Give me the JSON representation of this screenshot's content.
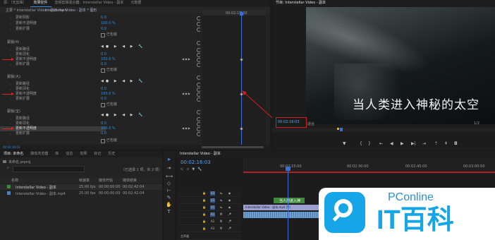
{
  "colors": {
    "accent": "#2d8ceb",
    "value_blue": "#3a8ddd",
    "timecode_blue": "#5aa6f0",
    "annotation_red": "#d41e1e",
    "clip_video": "#9b9fcf",
    "clip_audio": "#6f9fcf",
    "clip_green": "#3f8a3f",
    "playhead": "#3b6fd8"
  },
  "left_tabs": {
    "source": "源：（无剪辑）",
    "effect_controls": "效果控件",
    "audio_mixer": "音频剪辑混合器：Interstellar Video - 副本",
    "metadata": "元数据"
  },
  "ec_header": {
    "path": "主要 * Interstellar Video - 副本.mp4",
    "sequence": "Interstellar Video - 副本 * 图形",
    "timecode": "00:02:15:00"
  },
  "effect_rows": {
    "r1": {
      "label": "更新阴影",
      "value": "0.0"
    },
    "r2": {
      "label": "更新不透明度",
      "value": "100.0 %"
    },
    "r3": {
      "label": "更新扩展",
      "value": "0.0"
    },
    "r4": {
      "label": "已包装",
      "value": ""
    },
    "g1": {
      "label": "蒙版(4)"
    },
    "r5": {
      "label": "更新路径",
      "value": ""
    },
    "r6": {
      "label": "更新羽化",
      "value": "0.0"
    },
    "r7": {
      "label": "更新不透明度",
      "value": "100.0 %"
    },
    "r8": {
      "label": "更新扩展",
      "value": "0.0"
    },
    "r9": {
      "label": "已包装",
      "value": ""
    },
    "g2": {
      "label": "蒙版(大)"
    },
    "r10": {
      "label": "更新路径",
      "value": ""
    },
    "r11": {
      "label": "更新羽化",
      "value": "0.0"
    },
    "r12": {
      "label": "更新不透明度",
      "value": "100.0 %"
    },
    "r13": {
      "label": "更新扩展",
      "value": "0.0"
    },
    "r14": {
      "label": "已包装",
      "value": ""
    },
    "g3": {
      "label": "蒙版(宝)"
    },
    "r15": {
      "label": "更新路径",
      "value": ""
    },
    "r16": {
      "label": "更新羽化",
      "value": "0.0"
    },
    "r17": {
      "label": "更新不透明度",
      "value": "100.0 %"
    },
    "r18": {
      "label": "更新扩展",
      "value": "0.0"
    },
    "r19": {
      "label": "已包装",
      "value": ""
    }
  },
  "ec_bottom_timecode": "00:02:16:03",
  "program": {
    "title": "节目: Interstellar Video - 副本",
    "subtitle": "当人类进入神秘的太空",
    "timecode": "00:02:16:03",
    "fit": "适合",
    "ratio": "1/2"
  },
  "project": {
    "tabs": {
      "project": "项目: 未命名",
      "media_browser": "媒体浏览器",
      "library": "库",
      "info": "信息",
      "effects": "效果",
      "markers": "标记",
      "history": "历史"
    },
    "file": "未命名.prproj",
    "count": "（已选择 1 项，共 2 项）",
    "columns": {
      "name": "名称",
      "fps": "帧速率",
      "start": "媒体开始",
      "end": "媒体结束"
    },
    "items": [
      {
        "name": "Interstellar Video - 副本",
        "fps": "25.00 fps",
        "start": "00:00:00:00",
        "end": "00:02:42:04"
      },
      {
        "name": "Interstellar Video - 副本.mp4",
        "fps": "25.00 fps",
        "start": "00:00:00:00",
        "end": "00:02:42:04"
      }
    ]
  },
  "timeline": {
    "title": "Interstellar Video - 副本",
    "timecode": "00:02:16:03",
    "ruler": {
      "t1": "00:02:15:00",
      "t2": "00:02:30:00",
      "t3": "00:02:45:00",
      "t4": "00:03:00:00"
    },
    "tracks": {
      "v3": "V3",
      "v2": "V2",
      "v1": "V1",
      "a1": "A1",
      "a2": "A2",
      "a3": "A3",
      "master": "主声道"
    },
    "clip_title": "当人类进入神",
    "clip_video": "Interstellar Video - 副本.mp4 [V]"
  },
  "watermark": {
    "brand": "PConline",
    "name": "IT百科"
  }
}
